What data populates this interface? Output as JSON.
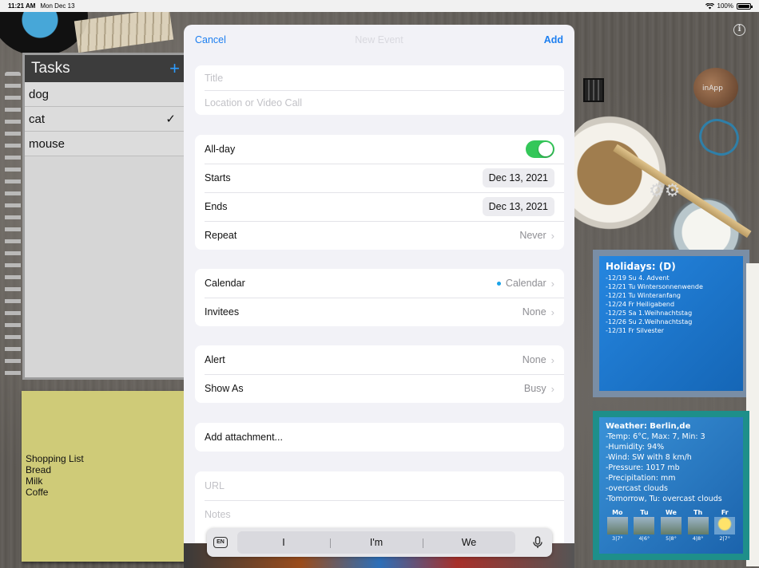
{
  "status_bar": {
    "time": "11:21 AM",
    "date": "Mon Dec 13",
    "battery": "100%",
    "battery_level": 1.0
  },
  "desk": {
    "inapp_label": "inApp"
  },
  "tasks_widget": {
    "title": "Tasks",
    "add_glyph": "+",
    "items": [
      {
        "label": "dog",
        "checked": false
      },
      {
        "label": "cat",
        "checked": true
      },
      {
        "label": "mouse",
        "checked": false
      }
    ]
  },
  "shopping_note": {
    "lines": [
      "Shopping List",
      "Bread",
      "Milk",
      "Coffe"
    ]
  },
  "holidays_widget": {
    "title": "Holidays: (D)",
    "entries": [
      "-12/19 Su 4. Advent",
      "-12/21 Tu Wintersonnenwende",
      "-12/21 Tu Winteranfang",
      "-12/24 Fr Heiligabend",
      "-12/25 Sa 1.Weihnachtstag",
      "-12/26 Su 2.Weihnachtstag",
      "-12/31 Fr Silvester"
    ]
  },
  "weather_widget": {
    "title": "Weather: Berlin,de",
    "lines": [
      "-Temp: 6°C, Max: 7, Min: 3",
      "-Humidity: 94%",
      "-Wind: SW with 8 km/h",
      "-Pressure: 1017 mb",
      "-Precipitation: mm",
      "-overcast clouds",
      "-Tomorrow, Tu: overcast clouds"
    ],
    "forecast": [
      {
        "day": "Mo",
        "temp": "3|7°",
        "icon": "cloudy-icon"
      },
      {
        "day": "Tu",
        "temp": "4|6°",
        "icon": "cloudy-icon"
      },
      {
        "day": "We",
        "temp": "5|8°",
        "icon": "cloudy-icon"
      },
      {
        "day": "Th",
        "temp": "4|8°",
        "icon": "cloudy-icon"
      },
      {
        "day": "Fr",
        "temp": "2|7°",
        "icon": "sun-icon"
      }
    ]
  },
  "new_event": {
    "cancel_label": "Cancel",
    "title": "New Event",
    "add_label": "Add",
    "title_placeholder": "Title",
    "location_placeholder": "Location or Video Call",
    "all_day_label": "All-day",
    "all_day_on": true,
    "starts_label": "Starts",
    "starts_value": "Dec 13, 2021",
    "ends_label": "Ends",
    "ends_value": "Dec 13, 2021",
    "repeat_label": "Repeat",
    "repeat_value": "Never",
    "calendar_label": "Calendar",
    "calendar_value": "Calendar",
    "calendar_color": "#1aa3e8",
    "invitees_label": "Invitees",
    "invitees_value": "None",
    "alert_label": "Alert",
    "alert_value": "None",
    "show_as_label": "Show As",
    "show_as_value": "Busy",
    "attachment_label": "Add attachment...",
    "url_placeholder": "URL",
    "notes_placeholder": "Notes"
  },
  "keyboard_bar": {
    "language": "EN",
    "suggestions": [
      "I",
      "I'm",
      "We"
    ]
  },
  "colors": {
    "accent": "#1d7ff0",
    "toggle_on": "#34c759"
  }
}
